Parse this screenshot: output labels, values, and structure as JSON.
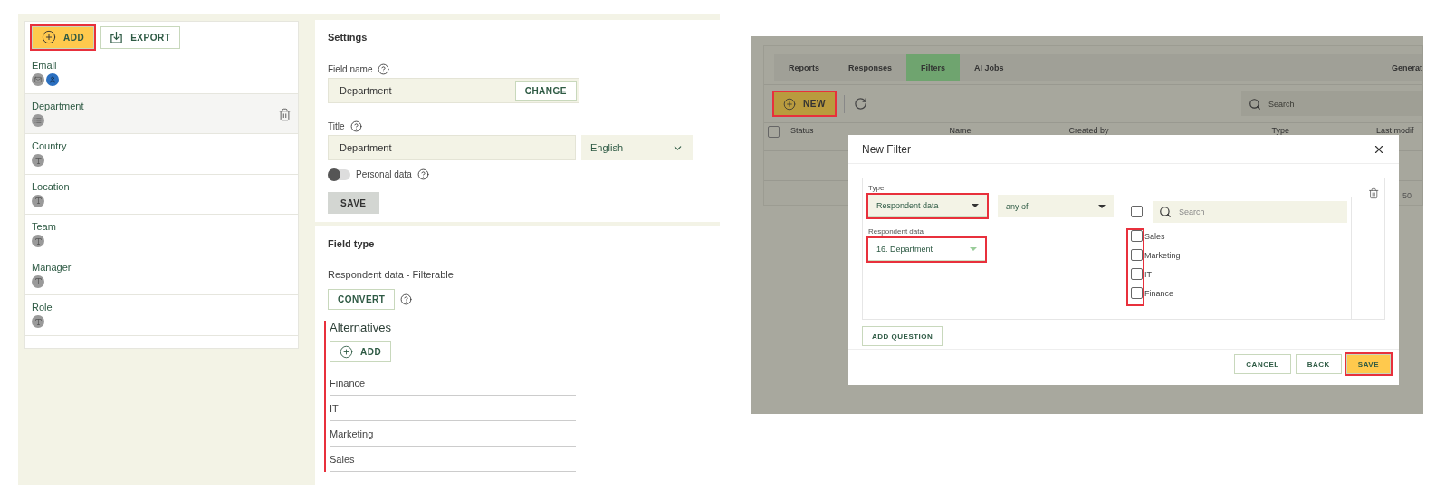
{
  "field_list": {
    "toolbar": [
      {
        "label": "ADD",
        "kind": "add",
        "highlighted": true
      },
      {
        "label": "EXPORT",
        "kind": "export",
        "highlighted": false
      }
    ],
    "fields": [
      {
        "name": "Email",
        "kind": "email",
        "selected": false
      },
      {
        "name": "Department",
        "kind": "choice",
        "selected": true
      },
      {
        "name": "Country",
        "kind": "text",
        "selected": false
      },
      {
        "name": "Location",
        "kind": "text",
        "selected": false
      },
      {
        "name": "Team",
        "kind": "text",
        "selected": false
      },
      {
        "name": "Manager",
        "kind": "text",
        "selected": false
      },
      {
        "name": "Role",
        "kind": "text",
        "selected": false
      }
    ]
  },
  "settings": {
    "heading": "Settings",
    "field_name": {
      "label": "Field name",
      "value": "Department",
      "button": "CHANGE"
    },
    "title": {
      "label": "Title",
      "value": "Department",
      "language": "English"
    },
    "personal_data": {
      "label": "Personal data",
      "on": false
    },
    "save": "SAVE"
  },
  "field_type": {
    "heading": "Field type",
    "type_text": "Respondent data - Filterable",
    "convert": "CONVERT",
    "alternatives": {
      "heading": "Alternatives",
      "highlighted": true,
      "add": "ADD",
      "items": [
        "Finance",
        "IT",
        "Marketing",
        "Sales"
      ]
    }
  },
  "app": {
    "tabs": [
      {
        "label": "Reports",
        "selected": false
      },
      {
        "label": "Responses",
        "selected": false
      },
      {
        "label": "Filters",
        "selected": true
      },
      {
        "label": "AI Jobs",
        "selected": false
      }
    ],
    "tab_overflow": "Generat",
    "new_button": {
      "label": "NEW",
      "highlighted": true
    },
    "search_placeholder": "Search",
    "table": {
      "all_checked": false,
      "columns": [
        "Status",
        "Name",
        "Created by",
        "Type",
        "Last modif"
      ],
      "cell": "50"
    }
  },
  "dialog": {
    "title": "New Filter",
    "condition": {
      "type_label": "Type",
      "type_value": "Respondent data",
      "type_highlighted": true,
      "operator": "any of",
      "source_label": "Respondent data",
      "source_value": "16. Department",
      "source_highlighted": true
    },
    "values": {
      "search_placeholder": "Search",
      "all_checked": false,
      "checkboxes_highlighted": true,
      "items": [
        {
          "label": "Sales",
          "checked": false
        },
        {
          "label": "Marketing",
          "checked": false
        },
        {
          "label": "IT",
          "checked": false
        },
        {
          "label": "Finance",
          "checked": false
        }
      ]
    },
    "add_question": "ADD QUESTION",
    "buttons": [
      {
        "label": "CANCEL",
        "kind": "plain",
        "highlighted": false
      },
      {
        "label": "BACK",
        "kind": "plain",
        "highlighted": false
      },
      {
        "label": "SAVE",
        "kind": "primary",
        "highlighted": true
      }
    ]
  }
}
